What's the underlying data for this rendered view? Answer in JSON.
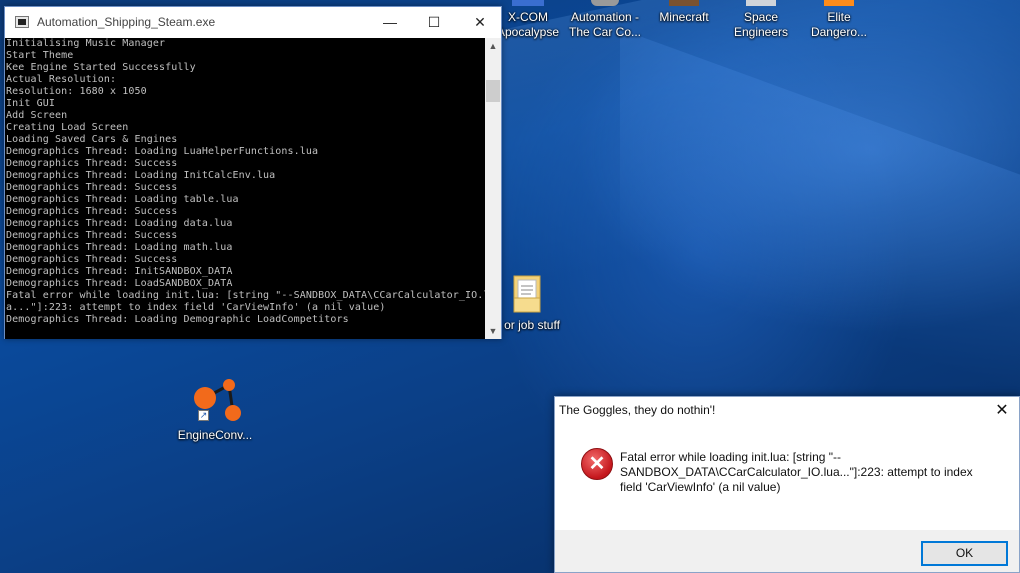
{
  "desktop": {
    "icons": [
      {
        "label": "X-COM\nApocalypse"
      },
      {
        "label": "Automation -\nThe Car Co..."
      },
      {
        "label": "Minecraft"
      },
      {
        "label": "Space\nEngineers"
      },
      {
        "label": "Elite\nDangero..."
      },
      {
        "label": "or job stuff"
      },
      {
        "label": "EngineConv..."
      }
    ]
  },
  "console": {
    "title": "Automation_Shipping_Steam.exe",
    "minimize": "—",
    "maximize": "☐",
    "close": "✕",
    "lines": [
      "Initialising Music Manager",
      "Start Theme",
      "Kee Engine Started Successfully",
      "Actual Resolution:",
      "Resolution: 1680 x 1050",
      "Init GUI",
      "Add Screen",
      "Creating Load Screen",
      "Loading Saved Cars & Engines",
      "Demographics Thread: Loading LuaHelperFunctions.lua",
      "Demographics Thread: Success",
      "Demographics Thread: Loading InitCalcEnv.lua",
      "Demographics Thread: Success",
      "Demographics Thread: Loading table.lua",
      "Demographics Thread: Success",
      "Demographics Thread: Loading data.lua",
      "Demographics Thread: Success",
      "Demographics Thread: Loading math.lua",
      "Demographics Thread: Success",
      "Demographics Thread: InitSANDBOX_DATA",
      "Demographics Thread: LoadSANDBOX_DATA",
      "Fatal error while loading init.lua: [string \"--SANDBOX_DATA\\CCarCalculator_IO.lu",
      "a...\"]:223: attempt to index field 'CarViewInfo' (a nil value)",
      "Demographics Thread: Loading Demographic LoadCompetitors"
    ]
  },
  "dialog": {
    "title": "The Goggles, they do nothin'!",
    "close": "✕",
    "message": "Fatal error while loading init.lua: [string \"--SANDBOX_DATA\\CCarCalculator_IO.lua...\"]:223: attempt to index field 'CarViewInfo' (a nil value)",
    "ok_label": "OK"
  },
  "colors": {
    "accent": "#0078d7",
    "error_red": "#c4161c"
  }
}
